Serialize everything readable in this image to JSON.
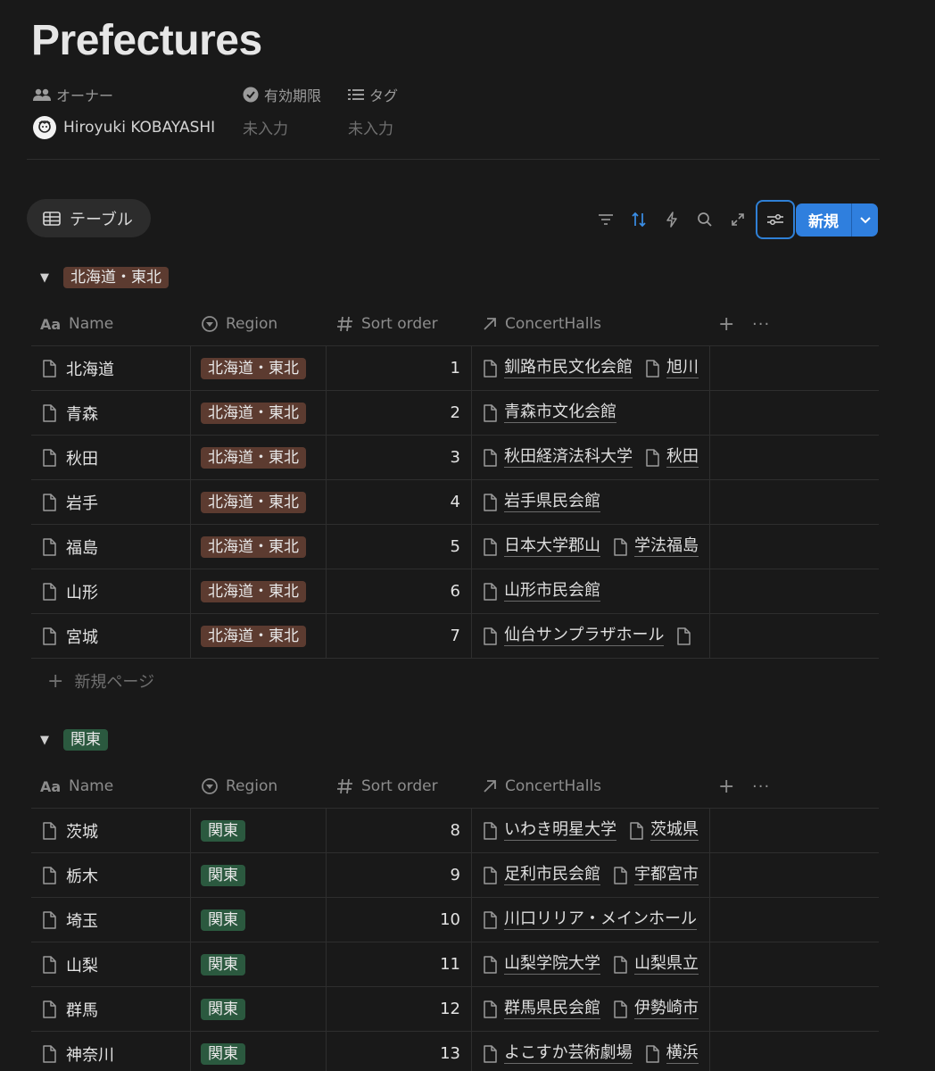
{
  "page": {
    "title": "Prefectures",
    "properties": [
      {
        "label": "オーナー",
        "value": "Hiroyuki KOBAYASHI",
        "icon": "people-icon"
      },
      {
        "label": "有効期限",
        "value": "未入力",
        "icon": "verified-icon"
      },
      {
        "label": "タグ",
        "value": "未入力",
        "icon": "list-icon"
      }
    ]
  },
  "view": {
    "tab_label": "テーブル",
    "new_label": "新規",
    "add_page_label": "新規ページ"
  },
  "columns": {
    "name": "Name",
    "region": "Region",
    "sort": "Sort order",
    "halls": "ConcertHalls"
  },
  "colors": {
    "brown_tag": "#5c3b30",
    "green_tag": "#2b593f",
    "accent": "#2f7fde"
  },
  "groups": [
    {
      "label": "北海道・東北",
      "color": "brown",
      "rows": [
        {
          "name": "北海道",
          "region": "北海道・東北",
          "sort": "1",
          "halls": [
            "釧路市民文化会館",
            "旭川"
          ]
        },
        {
          "name": "青森",
          "region": "北海道・東北",
          "sort": "2",
          "halls": [
            "青森市文化会館"
          ]
        },
        {
          "name": "秋田",
          "region": "北海道・東北",
          "sort": "3",
          "halls": [
            "秋田経済法科大学",
            "秋田"
          ]
        },
        {
          "name": "岩手",
          "region": "北海道・東北",
          "sort": "4",
          "halls": [
            "岩手県民会館"
          ]
        },
        {
          "name": "福島",
          "region": "北海道・東北",
          "sort": "5",
          "halls": [
            "日本大学郡山",
            "学法福島"
          ]
        },
        {
          "name": "山形",
          "region": "北海道・東北",
          "sort": "6",
          "halls": [
            "山形市民会館"
          ]
        },
        {
          "name": "宮城",
          "region": "北海道・東北",
          "sort": "7",
          "halls": [
            "仙台サンプラザホール",
            ""
          ]
        }
      ]
    },
    {
      "label": "関東",
      "color": "green",
      "rows": [
        {
          "name": "茨城",
          "region": "関東",
          "sort": "8",
          "halls": [
            "いわき明星大学",
            "茨城県"
          ]
        },
        {
          "name": "栃木",
          "region": "関東",
          "sort": "9",
          "halls": [
            "足利市民会館",
            "宇都宮市"
          ]
        },
        {
          "name": "埼玉",
          "region": "関東",
          "sort": "10",
          "halls": [
            "川口リリア・メインホール"
          ]
        },
        {
          "name": "山梨",
          "region": "関東",
          "sort": "11",
          "halls": [
            "山梨学院大学",
            "山梨県立"
          ]
        },
        {
          "name": "群馬",
          "region": "関東",
          "sort": "12",
          "halls": [
            "群馬県民会館",
            "伊勢崎市"
          ]
        },
        {
          "name": "神奈川",
          "region": "関東",
          "sort": "13",
          "halls": [
            "よこすか芸術劇場",
            "横浜"
          ]
        }
      ]
    }
  ]
}
